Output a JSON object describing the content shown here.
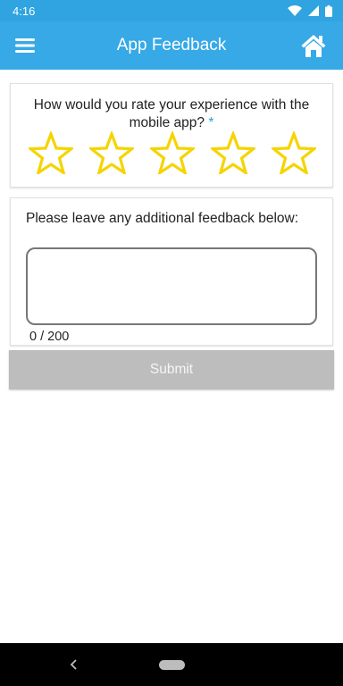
{
  "status_bar": {
    "time": "4:16",
    "icons": [
      "wifi-icon",
      "signal-icon",
      "battery-icon"
    ]
  },
  "app_bar": {
    "title": "App Feedback",
    "left_icon": "menu-icon",
    "right_icon": "home-icon"
  },
  "rating": {
    "question": "How would you rate your experience with the mobile app?",
    "required_mark": "*",
    "max_stars": 5,
    "selected": 0,
    "star_color": "#f5d400"
  },
  "feedback": {
    "label": "Please leave any additional feedback below:",
    "value": "",
    "counter": "0 / 200"
  },
  "submit": {
    "label": "Submit",
    "disabled": true
  },
  "colors": {
    "app_bar": "#36a9e6",
    "status_bar": "#2fa4e0",
    "submit_disabled": "#bdbdbd",
    "required": "#2f9fd8"
  }
}
